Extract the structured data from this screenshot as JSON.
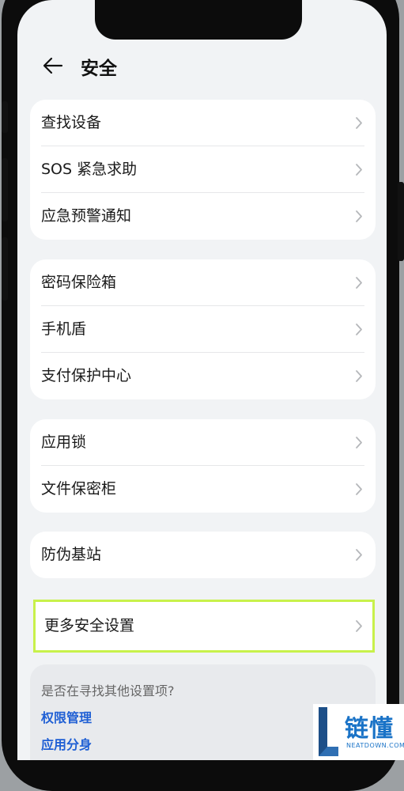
{
  "header": {
    "title": "安全"
  },
  "groups": [
    {
      "items": [
        "查找设备",
        "SOS 紧急求助",
        "应急预警通知"
      ]
    },
    {
      "items": [
        "密码保险箱",
        "手机盾",
        "支付保护中心"
      ]
    },
    {
      "items": [
        "应用锁",
        "文件保密柜"
      ]
    },
    {
      "items": [
        "防伪基站"
      ]
    }
  ],
  "highlighted_item": {
    "label": "更多安全设置"
  },
  "suggestions": {
    "title": "是否在寻找其他设置项?",
    "links": [
      "权限管理",
      "应用分身"
    ]
  },
  "watermark": {
    "text": "链懂",
    "subtext": "NEATDOWN.COM"
  },
  "colors": {
    "highlight": "#c8f14b",
    "link": "#1f5fd4",
    "background": "#f1f3f5"
  }
}
